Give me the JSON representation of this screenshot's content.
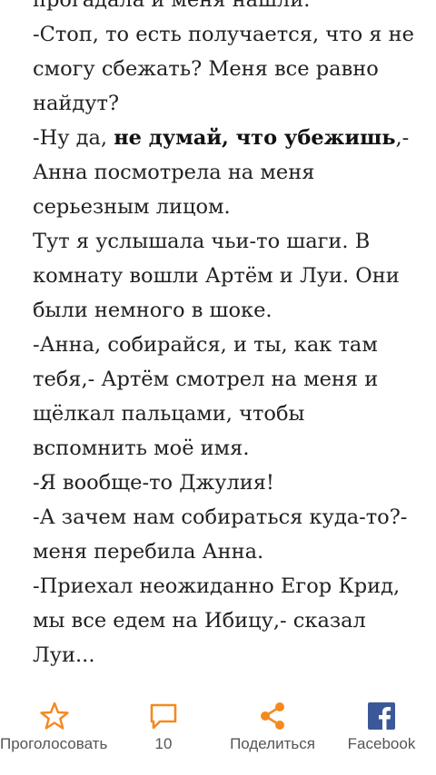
{
  "story": {
    "lines": [
      {
        "segments": [
          {
            "text": "прогадала и меня нашли.",
            "bold": false
          }
        ]
      },
      {
        "segments": [
          {
            "text": "-Стоп, то есть получается, что я не смогу сбежать? Меня все равно найдут?",
            "bold": false
          }
        ]
      },
      {
        "segments": [
          {
            "text": "-Ну да, ",
            "bold": false
          },
          {
            "text": "не думай, что убежишь",
            "bold": true
          },
          {
            "text": ",- Анна посмотрела на меня серьезным лицом.",
            "bold": false
          }
        ]
      },
      {
        "segments": [
          {
            "text": "Тут я услышала чьи-то шаги. В комнату вошли Артём и Луи. Они были немного в шоке.",
            "bold": false
          }
        ]
      },
      {
        "segments": [
          {
            "text": "-Анна, собирайся, и ты, как там тебя,- Артём смотрел на меня и щёлкал пальцами, чтобы вспомнить моё имя.",
            "bold": false
          }
        ]
      },
      {
        "segments": [
          {
            "text": "-Я вообще-то Джулия!",
            "bold": false
          }
        ]
      },
      {
        "segments": [
          {
            "text": "-А зачем нам собираться куда-то?- меня перебила Анна.",
            "bold": false
          }
        ]
      },
      {
        "segments": [
          {
            "text": "-Приехал неожиданно Егор Крид, мы все едем на Ибицу,- сказал Луи...",
            "bold": false
          }
        ]
      }
    ]
  },
  "bottom_bar": {
    "vote": {
      "label": "Проголосовать",
      "icon": "star-outline-icon"
    },
    "comments": {
      "label": "10",
      "icon": "comment-bubble-icon"
    },
    "share": {
      "label": "Поделиться",
      "icon": "share-icon"
    },
    "facebook": {
      "label": "Facebook",
      "icon": "facebook-icon"
    }
  },
  "colors": {
    "accent": "#F5891F",
    "facebook": "#3B5998",
    "text": "#222222",
    "label": "#555555"
  }
}
